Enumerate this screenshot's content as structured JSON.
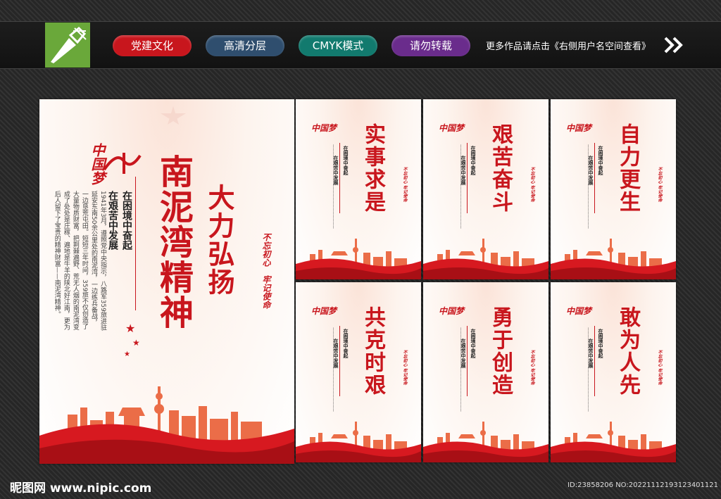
{
  "header": {
    "tags": [
      {
        "label": "党建文化",
        "color": "#c8161d"
      },
      {
        "label": "高清分层",
        "color": "#2f4e6e"
      },
      {
        "label": "CMYK模式",
        "color": "#127a6e"
      },
      {
        "label": "请勿转载",
        "color": "#6a2c8c"
      }
    ],
    "notice": "更多作品请点击《右侧用户名空间查看》",
    "logo_icon": "pen-nib-icon",
    "arrow_icon": "double-chevron-right-icon"
  },
  "main_poster": {
    "emblem": "中国梦",
    "title": "南泥湾精神",
    "slogan": "大力弘扬",
    "subtitle_1": "在困境中奋起",
    "subtitle_2": "在艰苦中发展",
    "body": "1941年3月，遵照党中央指示，八路军359旅进驻延安东南50余公里处的南泥湾，一边练兵备战，一边垦荒屯田。短短三年时间，359旅不仅创造了大量物质财富，把荆棘遍野、荒无人烟的南泥湾变成了处处是庄稼、遍地是牛羊的陕北好江南，更为后人留下了宝贵的精神财富——南泥湾精神。",
    "stamp_1": "不忘初心",
    "stamp_2": "牢记使命"
  },
  "small_posters": [
    {
      "title": "实事求是",
      "emblem": "中国梦",
      "subtitle_1": "在困境中奋起",
      "subtitle_2": "在艰苦中发展"
    },
    {
      "title": "艰苦奋斗",
      "emblem": "中国梦",
      "subtitle_1": "在困境中奋起",
      "subtitle_2": "在艰苦中发展"
    },
    {
      "title": "自力更生",
      "emblem": "中国梦",
      "subtitle_1": "在困境中奋起",
      "subtitle_2": "在艰苦中发展"
    },
    {
      "title": "共克时艰",
      "emblem": "中国梦",
      "subtitle_1": "在困境中奋起",
      "subtitle_2": "在艰苦中发展"
    },
    {
      "title": "勇于创造",
      "emblem": "中国梦",
      "subtitle_1": "在困境中奋起",
      "subtitle_2": "在艰苦中发展"
    },
    {
      "title": "敢为人先",
      "emblem": "中国梦",
      "subtitle_1": "在困境中奋起",
      "subtitle_2": "在艰苦中发展"
    }
  ],
  "small_stamp": "不忘初心 牢记使命",
  "footer": {
    "site": "昵图网 www.nipic.com",
    "id": "ID:23858206 NO:20221112193123401121"
  },
  "colors": {
    "accent": "#c8161d",
    "ribbon": "#d71920",
    "skyline": "#e8552a"
  }
}
